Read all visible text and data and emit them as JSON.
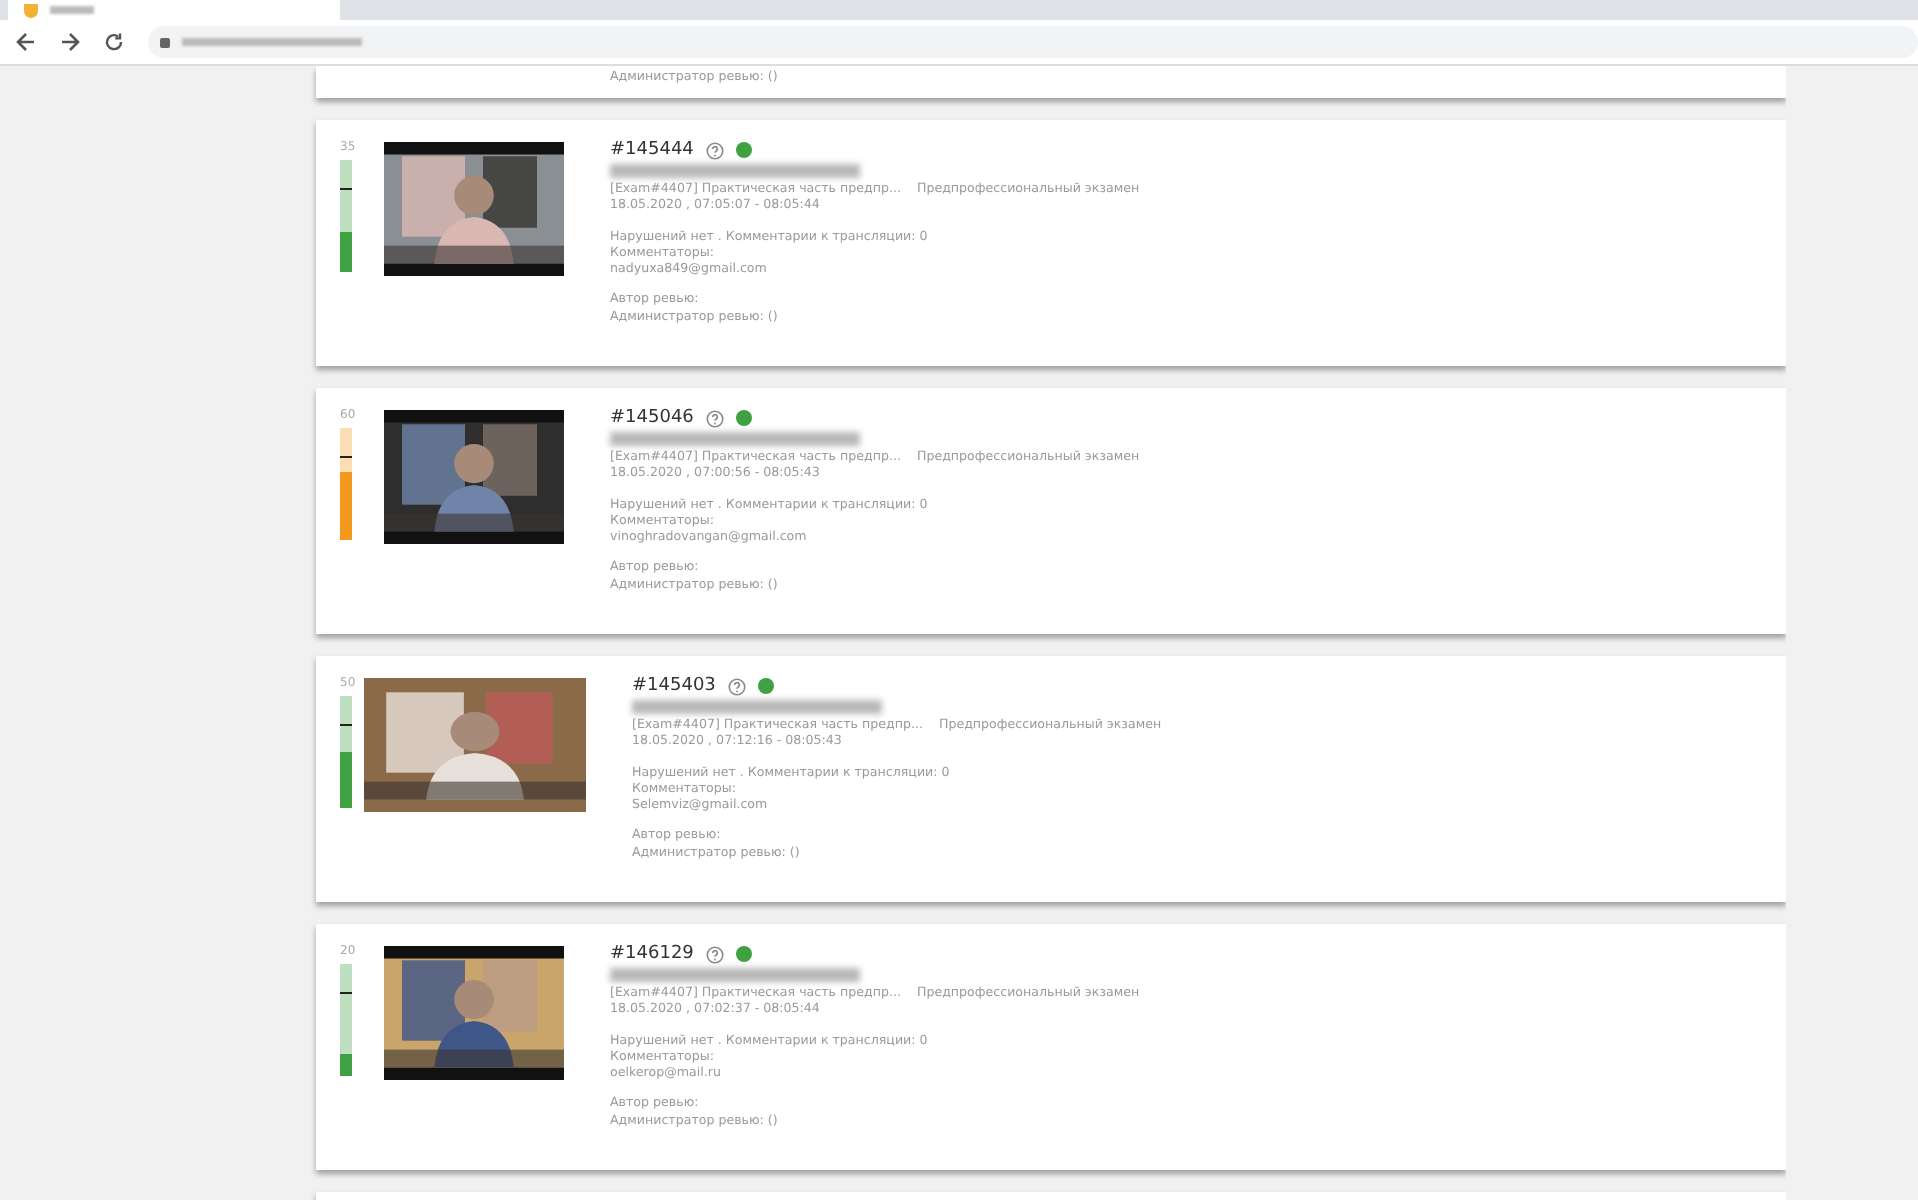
{
  "partial_card": {
    "admin_review": "Администратор ревью: ()"
  },
  "sessions": [
    {
      "score": "35",
      "level": 0.35,
      "color": "#3fa142",
      "id": "#145444",
      "online": true,
      "exam": "[Exam#4407] Практическая часть предпр...",
      "exam_type": "Предпрофессиональный экзамен",
      "time": "18.05.2020 , 07:05:07 - 08:05:44",
      "violations": "Нарушений нет . Комментарии к трансляции: 0",
      "commentators_label": "Комментаторы:",
      "email": "nadyuxa849@gmail.com",
      "review_author": "Автор ревью:",
      "admin_review": "Администратор ревью: ()"
    },
    {
      "score": "60",
      "level": 0.6,
      "color": "#f39a1e",
      "id": "#145046",
      "online": true,
      "exam": "[Exam#4407] Практическая часть предпр...",
      "exam_type": "Предпрофессиональный экзамен",
      "time": "18.05.2020 , 07:00:56 - 08:05:43",
      "violations": "Нарушений нет . Комментарии к трансляции: 0",
      "commentators_label": "Комментаторы:",
      "email": "vinoghradovangan@gmail.com",
      "review_author": "Автор ревью:",
      "admin_review": "Администратор ревью: ()"
    },
    {
      "score": "50",
      "level": 0.5,
      "color": "#3fa142",
      "id": "#145403",
      "online": true,
      "exam": "[Exam#4407] Практическая часть предпр...",
      "exam_type": "Предпрофессиональный экзамен",
      "time": "18.05.2020 , 07:12:16 - 08:05:43",
      "violations": "Нарушений нет . Комментарии к трансляции: 0",
      "commentators_label": "Комментаторы:",
      "email": "Selemviz@gmail.com",
      "review_author": "Автор ревью:",
      "admin_review": "Администратор ревью: ()"
    },
    {
      "score": "20",
      "level": 0.2,
      "color": "#3fa142",
      "id": "#146129",
      "online": true,
      "exam": "[Exam#4407] Практическая часть предпр...",
      "exam_type": "Предпрофессиональный экзамен",
      "time": "18.05.2020 , 07:02:37 - 08:05:44",
      "violations": "Нарушений нет . Комментарии к трансляции: 0",
      "commentators_label": "Комментаторы:",
      "email": "oelkerop@mail.ru",
      "review_author": "Автор ревью:",
      "admin_review": "Администратор ревью: ()"
    }
  ]
}
